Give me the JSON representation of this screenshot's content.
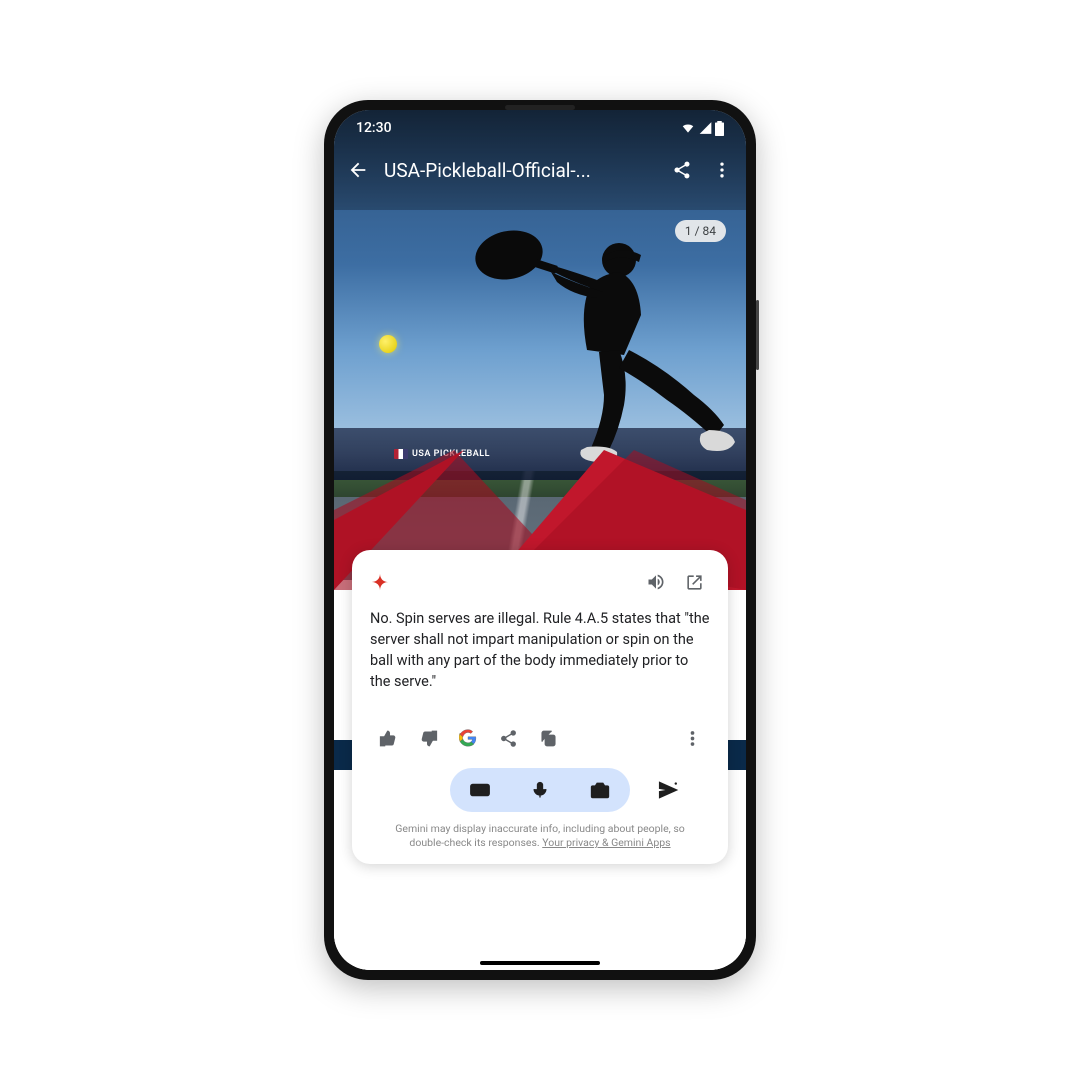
{
  "status": {
    "time": "12:30"
  },
  "appbar": {
    "title": "USA-Pickleball-Official-..."
  },
  "page_indicator": "1 / 84",
  "fence_text": "USA PICKLEBALL",
  "card": {
    "text": "No. Spin serves are illegal. Rule 4.A.5 states that \"the server shall not impart manipulation or spin on the ball with any part of the body immediately prior to the serve.\""
  },
  "disclaimer": {
    "line1": "Gemini may display inaccurate info, including about people, so",
    "line2_prefix": "double-check its responses. ",
    "link": "Your privacy & Gemini Apps"
  }
}
